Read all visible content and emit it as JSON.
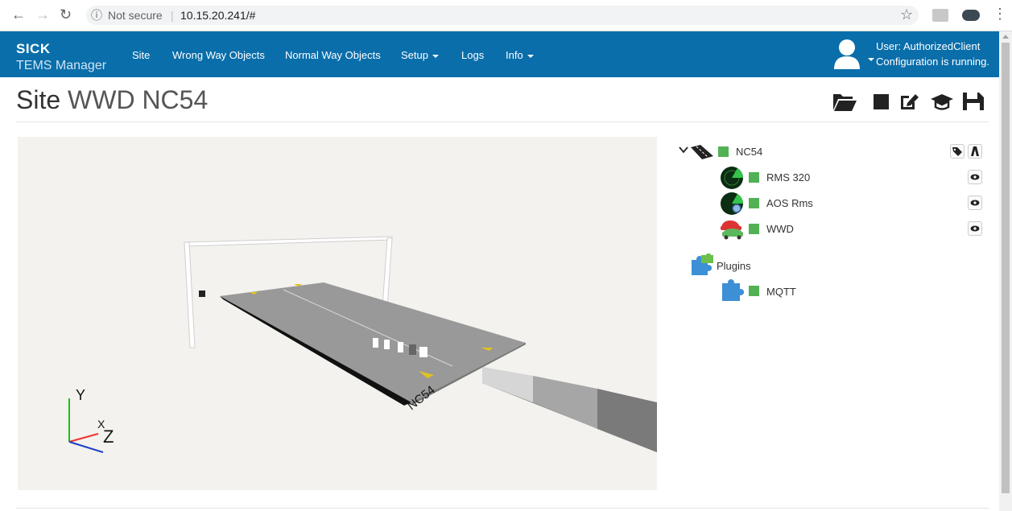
{
  "browser": {
    "security": "Not secure",
    "url": "10.15.20.241/#"
  },
  "navbar": {
    "brand_top": "SICK",
    "brand_bottom": "TEMS Manager",
    "items": [
      {
        "label": "Site"
      },
      {
        "label": "Wrong Way Objects"
      },
      {
        "label": "Normal Way Objects"
      },
      {
        "label": "Setup"
      },
      {
        "label": "Logs"
      },
      {
        "label": "Info"
      }
    ],
    "user_line1": "User: AuthorizedClient",
    "user_line2": "Configuration is running."
  },
  "page": {
    "title_prefix": "Site",
    "title_name": "WWD NC54"
  },
  "toolbar": [
    "folder-open-icon",
    "stop-icon",
    "edit-icon",
    "graduation-cap-icon",
    "save-icon"
  ],
  "viewport": {
    "road_label": "NC54",
    "axis_y": "Y",
    "axis_x": "X",
    "axis_z": "Z"
  },
  "tree": {
    "root": "NC54",
    "children": [
      {
        "label": "RMS 320",
        "icon": "radar-icon"
      },
      {
        "label": "AOS Rms",
        "icon": "radar-search-icon"
      },
      {
        "label": "WWD",
        "icon": "cars-icon"
      }
    ],
    "plugins_label": "Plugins",
    "plugins": [
      {
        "label": "MQTT",
        "icon": "puzzle-icon"
      }
    ]
  },
  "colors": {
    "navbar": "#0a6eaa",
    "status_ok": "#52b154",
    "viewport_bg": "#f3f2ee"
  }
}
